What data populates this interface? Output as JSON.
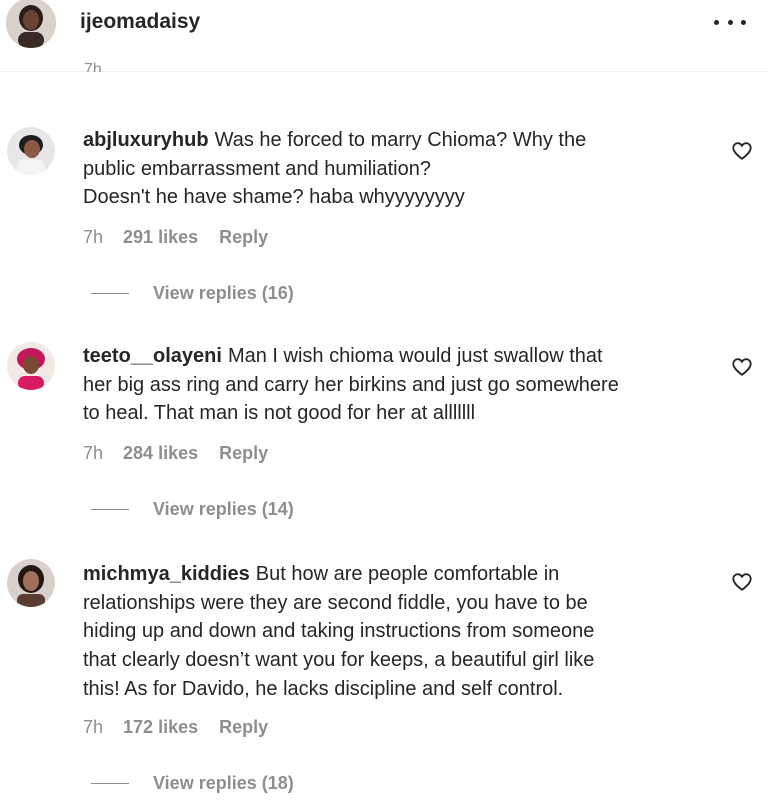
{
  "post": {
    "author": "ijeomadaisy",
    "clipped_time": "7h"
  },
  "comments": [
    {
      "username": "abjluxuryhub",
      "lines": [
        "Was he forced to marry Chioma? Why the",
        "public embarrassment and humiliation?",
        "Doesn't he have shame? haba whyyyyyyyy"
      ],
      "time": "7h",
      "likes": "291 likes",
      "reply_label": "Reply",
      "view_replies": "View replies (16)"
    },
    {
      "username": "teeto__olayeni",
      "lines": [
        "Man I wish chioma would just swallow that",
        "her big ass ring and carry her birkins and just go somewhere",
        "to heal. That man is not good for her at alllllll"
      ],
      "time": "7h",
      "likes": "284 likes",
      "reply_label": "Reply",
      "view_replies": "View replies (14)"
    },
    {
      "username": "michmya_kiddies",
      "lines": [
        "But how are people comfortable in",
        "relationships were they are second fiddle, you have to be",
        "hiding up and down and taking instructions from someone",
        "that clearly doesn’t want you for keeps, a beautiful girl like",
        "this! As for Davido, he lacks discipline and self control."
      ],
      "time": "7h",
      "likes": "172 likes",
      "reply_label": "Reply",
      "view_replies": "View replies (18)"
    }
  ]
}
